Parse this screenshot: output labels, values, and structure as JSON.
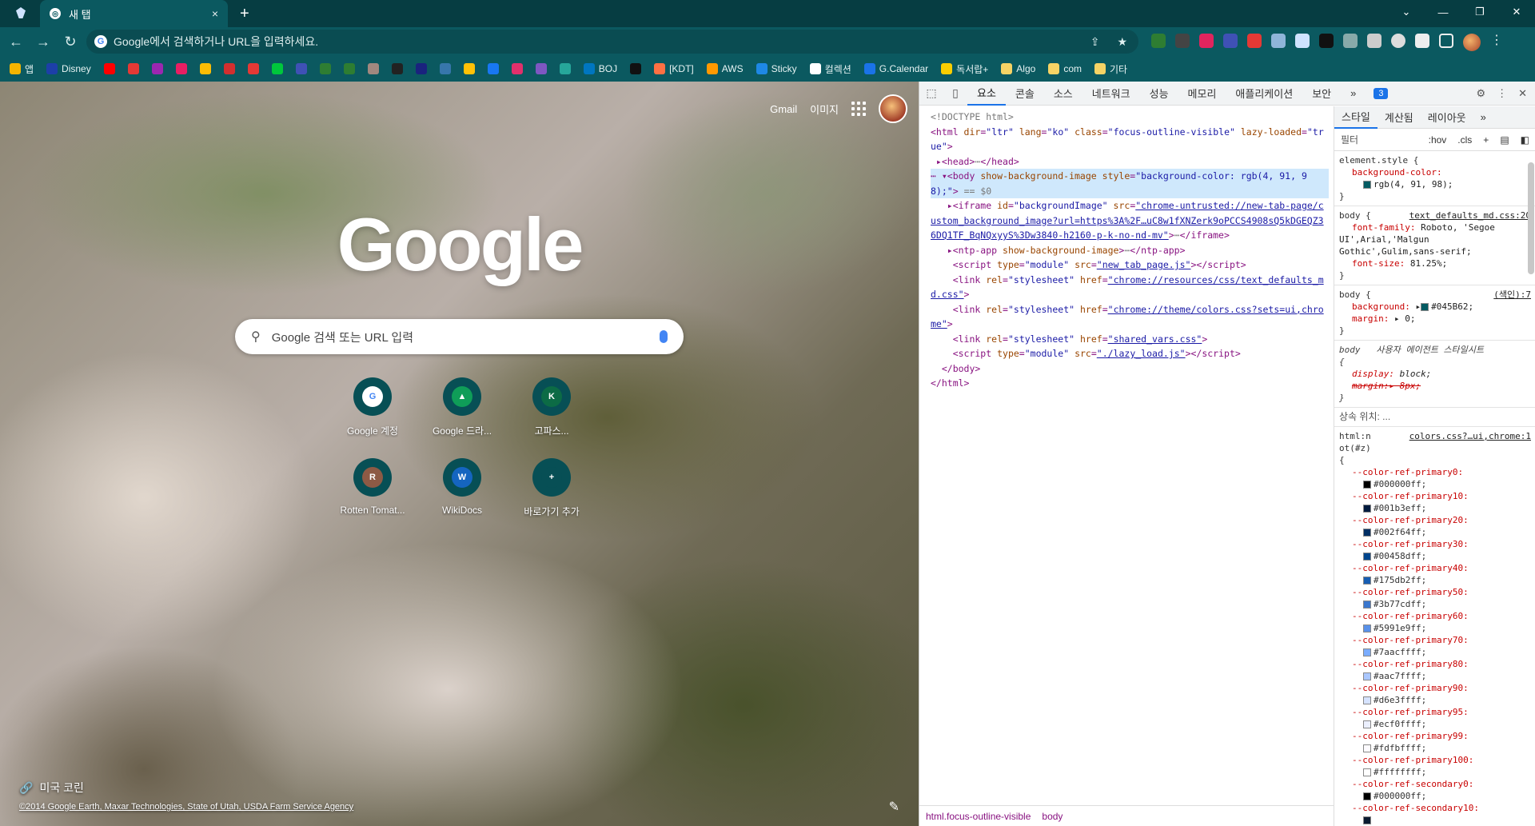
{
  "browser": {
    "tab": {
      "title": "새 탭",
      "favicon": "chrome-icon",
      "close": "×"
    },
    "new_tab": "+",
    "omnibox": {
      "text": "Google에서 검색하거나 URL을 입력하세요."
    },
    "window_controls": {
      "dropdown": "⌄",
      "minimize": "—",
      "restore": "❐",
      "close": "✕"
    },
    "bookmarks": [
      {
        "label": "앱",
        "color": "#f4b400"
      },
      {
        "label": "Disney",
        "color": "#1d3fa8"
      },
      {
        "label": "",
        "color": "#ff0000"
      },
      {
        "label": "",
        "color": "#e53935"
      },
      {
        "label": "",
        "color": "#9c27b0"
      },
      {
        "label": "",
        "color": "#e91e63"
      },
      {
        "label": "",
        "color": "#fbbc04"
      },
      {
        "label": "",
        "color": "#d32f2f"
      },
      {
        "label": "",
        "color": "#e53935"
      },
      {
        "label": "",
        "color": "#00c73c"
      },
      {
        "label": "",
        "color": "#3f51b5"
      },
      {
        "label": "",
        "color": "#2e7d32"
      },
      {
        "label": "",
        "color": "#2e7d32"
      },
      {
        "label": "",
        "color": "#a1887f"
      },
      {
        "label": "",
        "color": "#222222"
      },
      {
        "label": "",
        "color": "#1a237e"
      },
      {
        "label": "",
        "color": "#3776ab"
      },
      {
        "label": "",
        "color": "#ffc107"
      },
      {
        "label": "",
        "color": "#1877f2"
      },
      {
        "label": "",
        "color": "#e1306c"
      },
      {
        "label": "",
        "color": "#7e57c2"
      },
      {
        "label": "",
        "color": "#26a69a"
      },
      {
        "label": "BOJ",
        "color": "#0076c0"
      },
      {
        "label": "",
        "color": "#111111"
      },
      {
        "label": "[KDT]",
        "color": "#ff7043"
      },
      {
        "label": "AWS",
        "color": "#ff9900"
      },
      {
        "label": "Sticky",
        "color": "#1e88e5"
      },
      {
        "label": "컬렉션",
        "color": "#ffffff"
      },
      {
        "label": "G.Calendar",
        "color": "#1a73e8"
      },
      {
        "label": "독서랍+",
        "color": "#f9ce00"
      },
      {
        "label": "Algo",
        "color": "#f6d365"
      },
      {
        "label": "com",
        "color": "#f6d365"
      },
      {
        "label": "기타",
        "color": "#f6d365"
      }
    ]
  },
  "ntp": {
    "links": {
      "gmail": "Gmail",
      "images": "이미지"
    },
    "logo": "Google",
    "search_placeholder": "Google 검색 또는 URL 입력",
    "shortcuts": [
      {
        "label": "Google 계정",
        "letter": "G",
        "color": "#ffffff"
      },
      {
        "label": "Google 드라...",
        "letter": "▲",
        "color": "#0f9d58"
      },
      {
        "label": "고파스...",
        "letter": "K",
        "color": "#0c6b45"
      },
      {
        "label": "Rotten Tomat...",
        "letter": "R",
        "color": "#8d5a45"
      },
      {
        "label": "WikiDocs",
        "letter": "W",
        "color": "#1565c0"
      },
      {
        "label": "바로가기 추가",
        "letter": "+",
        "color": "#074f55"
      }
    ],
    "attribution": {
      "location": "미국 코린",
      "credit": "©2014 Google Earth, Maxar Technologies, State of Utah, USDA Farm Service Agency"
    }
  },
  "devtools": {
    "tabs": [
      "요소",
      "콘솔",
      "소스",
      "네트워크",
      "성능",
      "메모리",
      "애플리케이션",
      "보안"
    ],
    "more": "»",
    "issues_badge": "3",
    "breadcrumbs": [
      "html.focus-outline-visible",
      "body"
    ],
    "styles_tabs": [
      "스타일",
      "계산됨",
      "레이아웃"
    ],
    "filter": {
      "label": "필터",
      "hov": ":hov",
      "cls": ".cls",
      "plus": "+"
    },
    "dom_body_bg": "rgb(4, 91, 98)",
    "body_bg_hex": "#045B62",
    "inherited": "상속 위치: ...",
    "colors_source": "colors.css?…ui,chrome:1",
    "color_vars": [
      {
        "name": "--color-ref-primary0:",
        "value": "#000000ff;",
        "sw": "#000000"
      },
      {
        "name": "--color-ref-primary10:",
        "value": "#001b3eff;",
        "sw": "#001b3e"
      },
      {
        "name": "--color-ref-primary20:",
        "value": "#002f64ff;",
        "sw": "#002f64"
      },
      {
        "name": "--color-ref-primary30:",
        "value": "#00458dff;",
        "sw": "#00458d"
      },
      {
        "name": "--color-ref-primary40:",
        "value": "#175db2ff;",
        "sw": "#175db2"
      },
      {
        "name": "--color-ref-primary50:",
        "value": "#3b77cdff;",
        "sw": "#3b77cd"
      },
      {
        "name": "--color-ref-primary60:",
        "value": "#5991e9ff;",
        "sw": "#5991e9"
      },
      {
        "name": "--color-ref-primary70:",
        "value": "#7aacffff;",
        "sw": "#7aacff"
      },
      {
        "name": "--color-ref-primary80:",
        "value": "#aac7ffff;",
        "sw": "#aac7ff"
      },
      {
        "name": "--color-ref-primary90:",
        "value": "#d6e3ffff;",
        "sw": "#d6e3ff"
      },
      {
        "name": "--color-ref-primary95:",
        "value": "#ecf0ffff;",
        "sw": "#ecf0ff"
      },
      {
        "name": "--color-ref-primary99:",
        "value": "#fdfbffff;",
        "sw": "#fdfbff"
      },
      {
        "name": "--color-ref-primary100:",
        "value": "#ffffffff;",
        "sw": "#ffffff"
      },
      {
        "name": "--color-ref-secondary0:",
        "value": "#000000ff;",
        "sw": "#000000"
      },
      {
        "name": "--color-ref-secondary10:",
        "value": "",
        "sw": "#0a1a30"
      }
    ]
  }
}
